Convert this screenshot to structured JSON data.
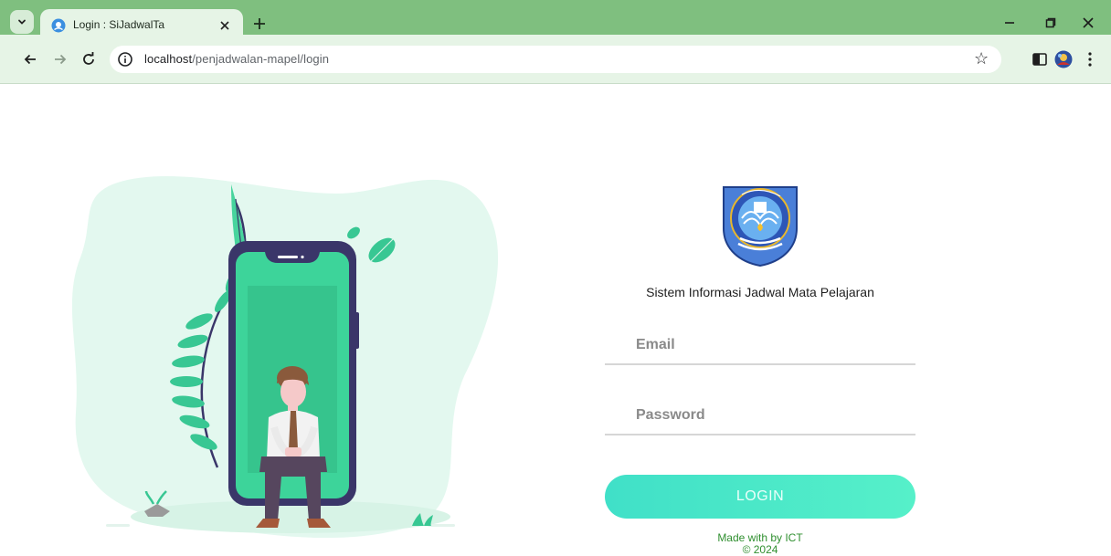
{
  "browser": {
    "tab_title": "Login : SiJadwalTa",
    "url_host": "localhost",
    "url_path": "/penjadwalan-mapel/login",
    "colors": {
      "frame": "#7fbf7f",
      "toolbar": "#e6f4e6"
    }
  },
  "icons": {
    "tab_search": "chevron-down-icon",
    "close_tab": "close-icon",
    "new_tab": "plus-icon",
    "back": "back-arrow-icon",
    "forward": "forward-arrow-icon",
    "reload": "reload-icon",
    "site_info": "info-icon",
    "bookmark": "star-icon",
    "side_panel": "side-panel-icon",
    "profile": "avatar-icon",
    "menu": "kebab-menu-icon"
  },
  "login": {
    "subtitle": "Sistem Informasi Jadwal Mata Pelajaran",
    "email_placeholder": "Email",
    "password_placeholder": "Password",
    "button_label": "LOGIN",
    "footer_line1": "Made with by ICT",
    "footer_line2": "© 2024",
    "colors": {
      "accent": "#4ee8c8",
      "illustration_green": "#3dd49a",
      "phone_frame": "#3a3669"
    }
  }
}
